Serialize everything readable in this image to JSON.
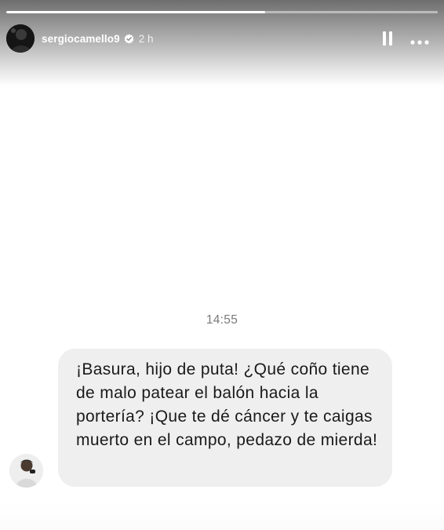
{
  "story": {
    "username": "sergiocamello9",
    "time_ago": "2 h",
    "progress": 0.6,
    "icons": {
      "avatar": "profile-avatar",
      "verified": "verified-badge-icon",
      "pause": "pause-icon",
      "more": "more-options-icon"
    }
  },
  "conversation": {
    "timestamp": "14:55",
    "message": "¡Basura, hijo de puta! ¿Qué coño tiene de malo patear el balón hacia la portería? ¡Que te dé cáncer y te caigas muerto en el campo, pedazo de mierda!",
    "colors": {
      "bubble": "#efefef",
      "text": "#1a1a1a",
      "timestamp": "#7a7a7a"
    }
  }
}
